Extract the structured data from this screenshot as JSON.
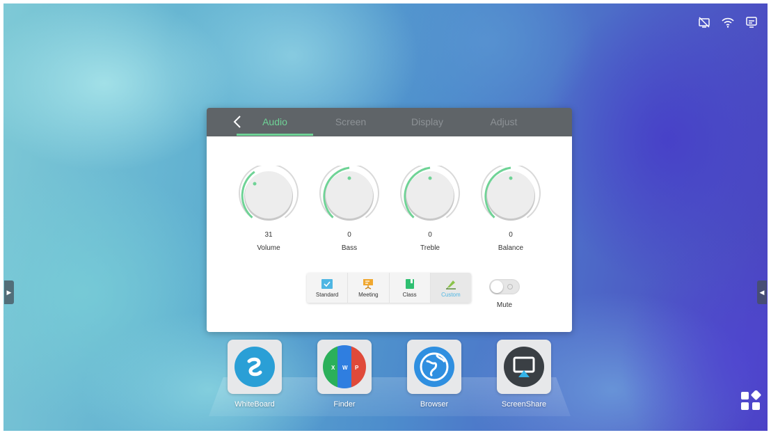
{
  "colors": {
    "accent": "#6fd396",
    "tabbar": "#5f6468",
    "custom_mode": "#4fb6e3"
  },
  "status_bar": {
    "icons": [
      "no-signal-icon",
      "wifi-icon",
      "screen-mirror-icon"
    ]
  },
  "panel": {
    "tabs": [
      {
        "label": "Audio",
        "active": true
      },
      {
        "label": "Screen",
        "active": false
      },
      {
        "label": "Display",
        "active": false
      },
      {
        "label": "Adjust",
        "active": false
      }
    ],
    "knobs": [
      {
        "label": "Volume",
        "value": "31"
      },
      {
        "label": "Bass",
        "value": "0"
      },
      {
        "label": "Treble",
        "value": "0"
      },
      {
        "label": "Balance",
        "value": "0"
      }
    ],
    "modes": [
      {
        "label": "Standard",
        "icon": "standard-icon"
      },
      {
        "label": "Meeting",
        "icon": "meeting-icon"
      },
      {
        "label": "Class",
        "icon": "class-icon"
      },
      {
        "label": "Custom",
        "icon": "custom-icon",
        "selected": true
      }
    ],
    "mute": {
      "label": "Mute",
      "on": false
    }
  },
  "dock": {
    "apps": [
      {
        "label": "WhiteBoard",
        "icon": "whiteboard-icon"
      },
      {
        "label": "Finder",
        "icon": "finder-icon",
        "letters": [
          "X",
          "W",
          "P"
        ]
      },
      {
        "label": "Browser",
        "icon": "globe-icon"
      },
      {
        "label": "ScreenShare",
        "icon": "screenshare-icon"
      }
    ]
  }
}
